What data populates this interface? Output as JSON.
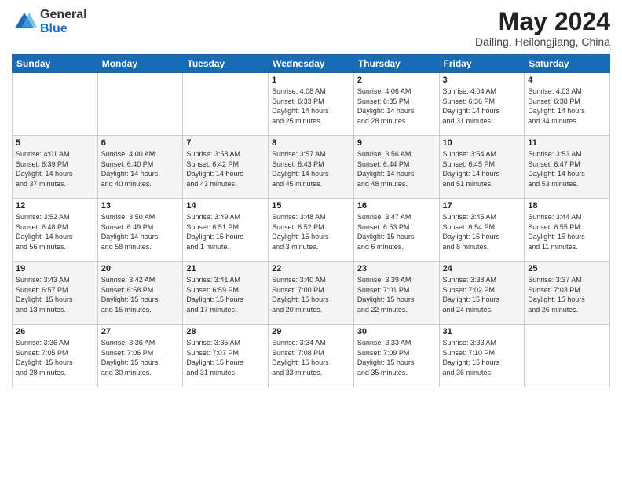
{
  "logo": {
    "general": "General",
    "blue": "Blue"
  },
  "title": "May 2024",
  "location": "Dailing, Heilongjiang, China",
  "headers": [
    "Sunday",
    "Monday",
    "Tuesday",
    "Wednesday",
    "Thursday",
    "Friday",
    "Saturday"
  ],
  "weeks": [
    [
      {
        "day": "",
        "info": ""
      },
      {
        "day": "",
        "info": ""
      },
      {
        "day": "",
        "info": ""
      },
      {
        "day": "1",
        "info": "Sunrise: 4:08 AM\nSunset: 6:33 PM\nDaylight: 14 hours\nand 25 minutes."
      },
      {
        "day": "2",
        "info": "Sunrise: 4:06 AM\nSunset: 6:35 PM\nDaylight: 14 hours\nand 28 minutes."
      },
      {
        "day": "3",
        "info": "Sunrise: 4:04 AM\nSunset: 6:36 PM\nDaylight: 14 hours\nand 31 minutes."
      },
      {
        "day": "4",
        "info": "Sunrise: 4:03 AM\nSunset: 6:38 PM\nDaylight: 14 hours\nand 34 minutes."
      }
    ],
    [
      {
        "day": "5",
        "info": "Sunrise: 4:01 AM\nSunset: 6:39 PM\nDaylight: 14 hours\nand 37 minutes."
      },
      {
        "day": "6",
        "info": "Sunrise: 4:00 AM\nSunset: 6:40 PM\nDaylight: 14 hours\nand 40 minutes."
      },
      {
        "day": "7",
        "info": "Sunrise: 3:58 AM\nSunset: 6:42 PM\nDaylight: 14 hours\nand 43 minutes."
      },
      {
        "day": "8",
        "info": "Sunrise: 3:57 AM\nSunset: 6:43 PM\nDaylight: 14 hours\nand 45 minutes."
      },
      {
        "day": "9",
        "info": "Sunrise: 3:56 AM\nSunset: 6:44 PM\nDaylight: 14 hours\nand 48 minutes."
      },
      {
        "day": "10",
        "info": "Sunrise: 3:54 AM\nSunset: 6:45 PM\nDaylight: 14 hours\nand 51 minutes."
      },
      {
        "day": "11",
        "info": "Sunrise: 3:53 AM\nSunset: 6:47 PM\nDaylight: 14 hours\nand 53 minutes."
      }
    ],
    [
      {
        "day": "12",
        "info": "Sunrise: 3:52 AM\nSunset: 6:48 PM\nDaylight: 14 hours\nand 56 minutes."
      },
      {
        "day": "13",
        "info": "Sunrise: 3:50 AM\nSunset: 6:49 PM\nDaylight: 14 hours\nand 58 minutes."
      },
      {
        "day": "14",
        "info": "Sunrise: 3:49 AM\nSunset: 6:51 PM\nDaylight: 15 hours\nand 1 minute."
      },
      {
        "day": "15",
        "info": "Sunrise: 3:48 AM\nSunset: 6:52 PM\nDaylight: 15 hours\nand 3 minutes."
      },
      {
        "day": "16",
        "info": "Sunrise: 3:47 AM\nSunset: 6:53 PM\nDaylight: 15 hours\nand 6 minutes."
      },
      {
        "day": "17",
        "info": "Sunrise: 3:45 AM\nSunset: 6:54 PM\nDaylight: 15 hours\nand 8 minutes."
      },
      {
        "day": "18",
        "info": "Sunrise: 3:44 AM\nSunset: 6:55 PM\nDaylight: 15 hours\nand 11 minutes."
      }
    ],
    [
      {
        "day": "19",
        "info": "Sunrise: 3:43 AM\nSunset: 6:57 PM\nDaylight: 15 hours\nand 13 minutes."
      },
      {
        "day": "20",
        "info": "Sunrise: 3:42 AM\nSunset: 6:58 PM\nDaylight: 15 hours\nand 15 minutes."
      },
      {
        "day": "21",
        "info": "Sunrise: 3:41 AM\nSunset: 6:59 PM\nDaylight: 15 hours\nand 17 minutes."
      },
      {
        "day": "22",
        "info": "Sunrise: 3:40 AM\nSunset: 7:00 PM\nDaylight: 15 hours\nand 20 minutes."
      },
      {
        "day": "23",
        "info": "Sunrise: 3:39 AM\nSunset: 7:01 PM\nDaylight: 15 hours\nand 22 minutes."
      },
      {
        "day": "24",
        "info": "Sunrise: 3:38 AM\nSunset: 7:02 PM\nDaylight: 15 hours\nand 24 minutes."
      },
      {
        "day": "25",
        "info": "Sunrise: 3:37 AM\nSunset: 7:03 PM\nDaylight: 15 hours\nand 26 minutes."
      }
    ],
    [
      {
        "day": "26",
        "info": "Sunrise: 3:36 AM\nSunset: 7:05 PM\nDaylight: 15 hours\nand 28 minutes."
      },
      {
        "day": "27",
        "info": "Sunrise: 3:36 AM\nSunset: 7:06 PM\nDaylight: 15 hours\nand 30 minutes."
      },
      {
        "day": "28",
        "info": "Sunrise: 3:35 AM\nSunset: 7:07 PM\nDaylight: 15 hours\nand 31 minutes."
      },
      {
        "day": "29",
        "info": "Sunrise: 3:34 AM\nSunset: 7:08 PM\nDaylight: 15 hours\nand 33 minutes."
      },
      {
        "day": "30",
        "info": "Sunrise: 3:33 AM\nSunset: 7:09 PM\nDaylight: 15 hours\nand 35 minutes."
      },
      {
        "day": "31",
        "info": "Sunrise: 3:33 AM\nSunset: 7:10 PM\nDaylight: 15 hours\nand 36 minutes."
      },
      {
        "day": "",
        "info": ""
      }
    ]
  ]
}
